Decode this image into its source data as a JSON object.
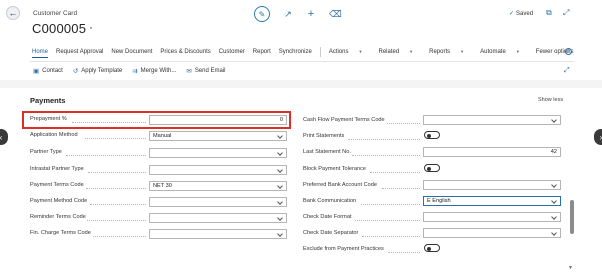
{
  "header": {
    "card_label": "Customer Card",
    "record_title": "C000005",
    "title_dot": "·",
    "saved_label": "Saved",
    "icons": [
      "back-arrow-icon",
      "edit-pencil-icon",
      "share-icon",
      "add-icon",
      "delete-icon",
      "open-new-window-icon",
      "collapse-icon"
    ]
  },
  "menu": {
    "items": [
      "Home",
      "Request Approval",
      "New Document",
      "Prices & Discounts",
      "Customer",
      "Report",
      "Synchronize"
    ],
    "dropdowns": [
      "Actions",
      "Related",
      "Reports",
      "Automate"
    ],
    "fewer_options": "Fewer options"
  },
  "subbar": {
    "items": [
      "Contact",
      "Apply Template",
      "Merge With...",
      "Send Email"
    ]
  },
  "section": {
    "title": "Payments",
    "show_less": "Show less"
  },
  "left_fields": [
    {
      "label": "Prepayment %",
      "value": "0"
    },
    {
      "label": "Application Method",
      "value": "Manual"
    },
    {
      "label": "Partner Type",
      "value": ""
    },
    {
      "label": "Intrastat Partner Type",
      "value": ""
    },
    {
      "label": "Payment Terms Code",
      "value": "NET 30"
    },
    {
      "label": "Payment Method Code",
      "value": ""
    },
    {
      "label": "Reminder Terms Code",
      "value": ""
    },
    {
      "label": "Fin. Charge Terms Code",
      "value": ""
    }
  ],
  "right_fields": [
    {
      "label": "Cash Flow Payment Terms Code",
      "value": ""
    },
    {
      "label": "Print Statements",
      "value": "off"
    },
    {
      "label": "Last Statement No.",
      "value": "42"
    },
    {
      "label": "Block Payment Tolerance",
      "value": "off"
    },
    {
      "label": "Preferred Bank Account Code",
      "value": ""
    },
    {
      "label": "Bank Communication",
      "value": "E English"
    },
    {
      "label": "Check Date Format",
      "value": ""
    },
    {
      "label": "Check Date Separator",
      "value": ""
    },
    {
      "label": "Exclude from Payment Practices",
      "value": "off"
    }
  ],
  "colors": {
    "accent": "#2a6fa8",
    "highlight": "#d9302a"
  }
}
